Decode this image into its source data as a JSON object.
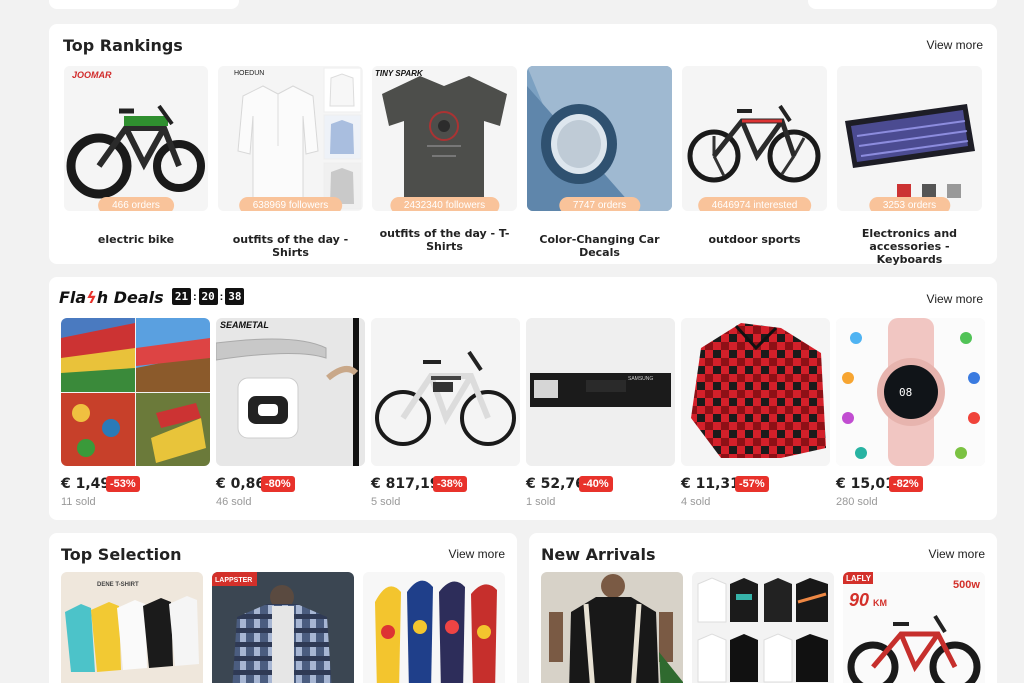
{
  "top_rankings": {
    "title": "Top Rankings",
    "view_more": "View more",
    "items": [
      {
        "badge": "466 orders",
        "label": "electric bike",
        "brand": "JOOMAR"
      },
      {
        "badge": "638969 followers",
        "label": "outfits of the day - Shirts",
        "brand": "HOEDUN"
      },
      {
        "badge": "2432340 followers",
        "label": "outfits of the day - T-Shirts",
        "brand": "TINY SPARK"
      },
      {
        "badge": "7747 orders",
        "label": "Color-Changing Car Decals"
      },
      {
        "badge": "4646974 interested",
        "label": "outdoor sports"
      },
      {
        "badge": "3253 orders",
        "label": "Electronics and accessories - Keyboards"
      }
    ]
  },
  "flash_deals": {
    "title_left": "Fla",
    "title_bolt": "ϟ",
    "title_right": "h Deals",
    "timer": {
      "hours": "21",
      "minutes": "20",
      "seconds": "38",
      "sep": ":"
    },
    "view_more": "View more",
    "items": [
      {
        "price": "€ 1,49",
        "discount": "-53%",
        "sold": "11 sold"
      },
      {
        "price": "€ 0,86",
        "discount": "-80%",
        "sold": "46 sold",
        "brand": "SEAMETAL"
      },
      {
        "price": "€ 817,19",
        "discount": "-38%",
        "sold": "5 sold"
      },
      {
        "price": "€ 52,76",
        "discount": "-40%",
        "sold": "1 sold",
        "brand": "SAMSUNG"
      },
      {
        "price": "€ 11,31",
        "discount": "-57%",
        "sold": "4 sold"
      },
      {
        "price": "€ 15,01",
        "discount": "-82%",
        "sold": "280 sold"
      }
    ]
  },
  "top_selection": {
    "title": "Top Selection",
    "view_more": "View more",
    "brands": [
      "DENE T-SHIRT",
      "LAPPSTER"
    ]
  },
  "new_arrivals": {
    "title": "New Arrivals",
    "view_more": "View more",
    "ebike_text": {
      "brand": "LAFLY",
      "watt": "500w",
      "range": "90",
      "unit": "KM"
    }
  },
  "colors": {
    "badge": "#f9c39a",
    "discount": "#e8322b",
    "background": "#f2f2f2"
  }
}
